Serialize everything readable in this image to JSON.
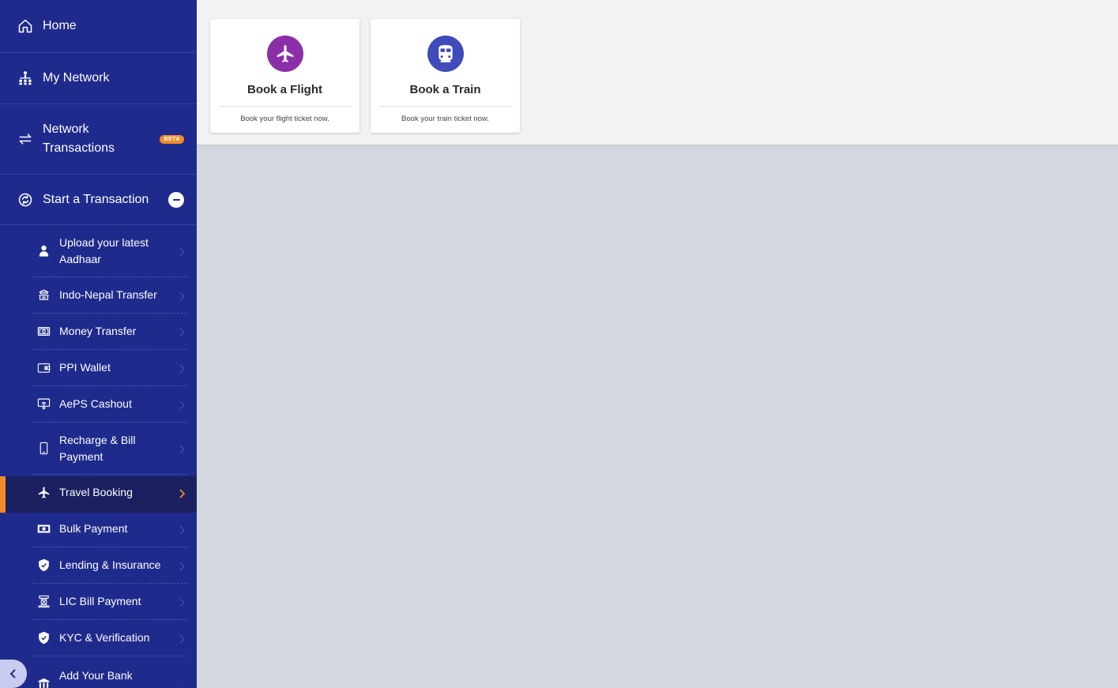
{
  "sidebar": {
    "home": {
      "label": "Home",
      "icon": "home-icon"
    },
    "my_network": {
      "label": "My Network",
      "icon": "network-icon"
    },
    "network_transactions": {
      "label": "Network Transactions",
      "icon": "arrows-icon",
      "badge": "BETA"
    },
    "start_transaction": {
      "label": "Start a Transaction",
      "icon": "transaction-icon"
    },
    "sub_items": [
      {
        "label": "Upload your latest Aadhaar",
        "icon": "user-icon"
      },
      {
        "label": "Indo-Nepal Transfer",
        "icon": "temple-icon"
      },
      {
        "label": "Money Transfer",
        "icon": "cash-icon"
      },
      {
        "label": "PPI Wallet",
        "icon": "wallet-icon"
      },
      {
        "label": "AePS Cashout",
        "icon": "fingerprint-icon"
      },
      {
        "label": "Recharge & Bill Payment",
        "icon": "mobile-icon"
      },
      {
        "label": "Travel Booking",
        "icon": "plane-icon",
        "active": true
      },
      {
        "label": "Bulk Payment",
        "icon": "money-icon"
      },
      {
        "label": "Lending & Insurance",
        "icon": "shield-icon"
      },
      {
        "label": "LIC Bill Payment",
        "icon": "lic-icon"
      },
      {
        "label": "KYC & Verification",
        "icon": "shield-check-icon"
      },
      {
        "label": "Add Your Bank",
        "icon": "bank-icon"
      }
    ]
  },
  "cards": [
    {
      "title": "Book a Flight",
      "desc": "Book your flight ticket now.",
      "icon": "plane-icon",
      "color": "#8b2fa8"
    },
    {
      "title": "Book a Train",
      "desc": "Book your train ticket now.",
      "icon": "train-icon",
      "color": "#3f4bb8"
    }
  ],
  "colors": {
    "sidebar": "#1f2b8c",
    "accent": "#f28c28",
    "active_bg": "#1a2060"
  }
}
